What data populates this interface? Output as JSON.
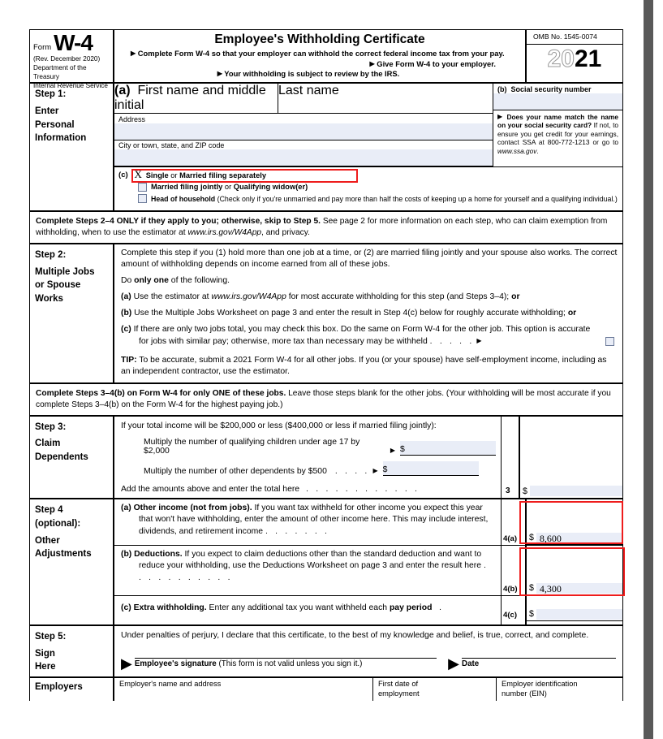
{
  "header": {
    "form_label": "Form",
    "form_number": "W-4",
    "revision": "(Rev. December 2020)",
    "dept": "Department of the Treasury",
    "agency": "Internal Revenue Service",
    "title": "Employee's Withholding Certificate",
    "bullet1": "Complete Form W-4 so that your employer can withhold the correct federal income tax from your pay.",
    "bullet2": "Give Form W-4 to your employer.",
    "bullet3": "Your withholding is subject to review by the IRS.",
    "omb": "OMB No. 1545-0074",
    "year_hollow": "20",
    "year_solid": "21"
  },
  "step1": {
    "label_line1": "Step 1:",
    "label_line2": "Enter",
    "label_line3": "Personal",
    "label_line4": "Information",
    "a_code": "(a)",
    "first_name_label": "First name and middle initial",
    "first_name_value": "",
    "last_name_label": "Last name",
    "last_name_value": "",
    "address_label": "Address",
    "address_value": "",
    "city_label": "City or town, state, and ZIP code",
    "city_value": "",
    "b_code": "(b)",
    "ssn_label": "Social security number",
    "ssn_value": "",
    "ssa_note": "Does your name match the name on your social security card? If not, to ensure you get credit for your earnings, contact SSA at 800-772-1213 or go to www.ssa.gov.",
    "ssa_note_bold": "Does your name match the name on your social security card?",
    "c_code": "(c)",
    "filing_options": [
      {
        "label_bold": "Single",
        "label_mid": " or ",
        "label_bold2": "Married filing separately",
        "label_rest": "",
        "checked": true,
        "mark": "X",
        "highlighted": true
      },
      {
        "label_bold": "Married filing jointly",
        "label_mid": " or ",
        "label_bold2": "Qualifying widow(er)",
        "label_rest": "",
        "checked": false,
        "mark": "",
        "highlighted": false
      },
      {
        "label_bold": "Head of household",
        "label_mid": " ",
        "label_bold2": "",
        "label_rest": "(Check only if you're unmarried and pay more than half the costs of keeping up a home for yourself and a qualifying individual.)",
        "checked": false,
        "mark": "",
        "highlighted": false
      }
    ]
  },
  "note1": {
    "bold": "Complete Steps 2–4 ONLY if they apply to you; otherwise, skip to Step 5.",
    "rest": " See page 2 for more information on each step, who can claim exemption from withholding, when to use the estimator at ",
    "italic": "www.irs.gov/W4App",
    "tail": ", and privacy."
  },
  "step2": {
    "label_line1": "Step 2:",
    "label_line2": "Multiple Jobs",
    "label_line3": "or Spouse",
    "label_line4": "Works",
    "intro": "Complete this step if you (1) hold more than one job at a time, or (2) are married filing jointly and your spouse also works. The correct amount of withholding depends on income earned from all of these jobs.",
    "do_only": {
      "pre": "Do ",
      "bold": "only one",
      "post": " of the following."
    },
    "option_a": {
      "code": "(a)",
      "pre": "Use the estimator at ",
      "italic": "www.irs.gov/W4App",
      "post": " for most accurate withholding for this step (and Steps 3–4); ",
      "bold_tail": "or"
    },
    "option_b": {
      "code": "(b)",
      "text": "Use the Multiple Jobs Worksheet on page 3 and enter the result in Step 4(c) below for roughly accurate withholding; ",
      "bold_tail": "or"
    },
    "option_c": {
      "code": "(c)",
      "text": "If there are only two jobs total, you may check this box. Do the same on Form W-4 for the other job. This option is accurate for jobs with similar pay; otherwise, more tax than necessary may be withheld",
      "dots": ".     .     .     .     ."
    },
    "tip": {
      "bold": "TIP:",
      "text": " To be accurate, submit a 2021 Form W-4 for all other jobs. If you (or your spouse) have self-employment income, including as an independent contractor, use the estimator."
    }
  },
  "note2": {
    "bold": "Complete Steps 3–4(b) on Form W-4 for only ONE of these jobs.",
    "rest": " Leave those steps blank for the other jobs. (Your withholding will be most accurate if you complete Steps 3–4(b) on the Form W-4 for the highest paying job.)"
  },
  "step3": {
    "label_line1": "Step 3:",
    "label_line2": "Claim",
    "label_line3": "Dependents",
    "intro": "If your total income will be $200,000 or less ($400,000 or less if married filing jointly):",
    "line_children": "Multiply the number of qualifying children under age 17 by $2,000",
    "children_value": "",
    "line_other": "Multiply the number of other dependents by $500",
    "other_dots": ".     .     .     .",
    "other_value": "",
    "line_total": "Add the amounts above and enter the total here",
    "total_dots": ".     .     .     .     .     .     .     .     .     .     .     .",
    "total_code": "3",
    "total_value": "",
    "dollar": "$"
  },
  "step4": {
    "label_line1": "Step 4",
    "label_line2": "(optional):",
    "label_line3": "Other",
    "label_line4": "Adjustments",
    "a": {
      "code": "(a)",
      "bold": "Other income (not from jobs).",
      "text": " If you want tax withheld for other income you expect this year that won't have withholding, enter the amount of other income here. This may include interest, dividends, and retirement income",
      "dots": ".     .     .     .     .     .     .",
      "field_code": "4(a)",
      "dollar": "$",
      "value": "8,600",
      "highlighted": true
    },
    "b": {
      "code": "(b)",
      "bold": "Deductions.",
      "text": " If you expect to claim deductions other than the standard deduction and want to reduce your withholding, use the Deductions Worksheet on page 3 and enter the result here",
      "dots": ".     .     .     .     .     .     .     .     .     .     .",
      "field_code": "4(b)",
      "dollar": "$",
      "value": "4,300",
      "highlighted": true
    },
    "c": {
      "code": "(c)",
      "bold": "Extra withholding.",
      "text": " Enter any additional tax you want withheld each ",
      "bold2": "pay period",
      "dots": ".",
      "field_code": "4(c)",
      "dollar": "$",
      "value": "",
      "highlighted": false
    }
  },
  "step5": {
    "label_line1": "Step 5:",
    "label_line2": "Sign",
    "label_line3": "Here",
    "declaration": "Under penalties of perjury, I declare that this certificate, to the best of my knowledge and belief, is true, correct, and complete.",
    "signature_bold": "Employee's signature",
    "signature_rest": " (This form is not valid unless you sign it.)",
    "date_label": "Date"
  },
  "employers": {
    "label": "Employers",
    "name_address_label": "Employer's name and address",
    "first_date_label": "First date of",
    "first_date_label2": "employment",
    "ein_label": "Employer identification",
    "ein_label2": "number (EIN)"
  },
  "colors": {
    "annotation": "#ee1c1c",
    "field_shade": "#e9edf7",
    "checkbox_border": "#6b7a99"
  }
}
